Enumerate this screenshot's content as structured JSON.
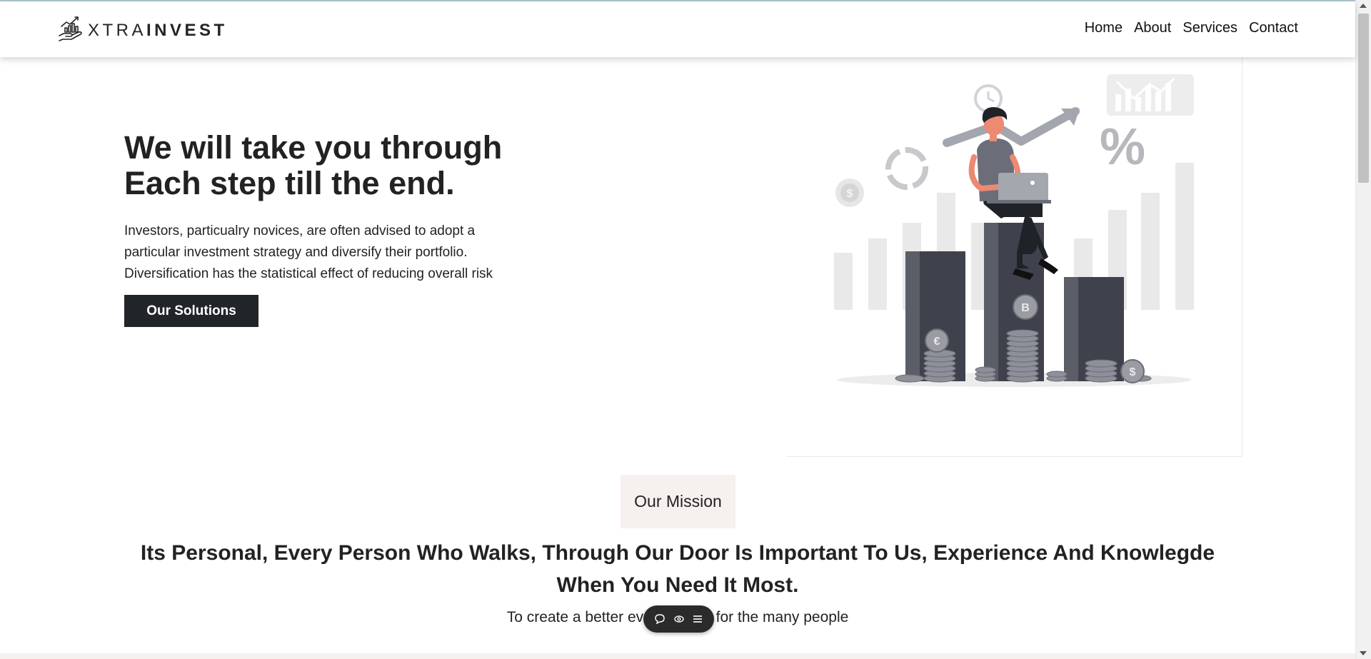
{
  "brand": {
    "name_light": "XTRA",
    "name_bold": "INVEST",
    "icon": "hand-chart-icon"
  },
  "nav": {
    "items": [
      {
        "label": "Home"
      },
      {
        "label": "About"
      },
      {
        "label": "Services"
      },
      {
        "label": "Contact"
      }
    ]
  },
  "hero": {
    "title_line1": "We will take you through",
    "title_line2": "Each step till the end.",
    "text_line1": "Investors, particualry novices, are often advised to adopt a",
    "text_line2": "particular investment strategy and diversify their portfolio.",
    "text_line3": "Diversification has the statistical effect of reducing overall risk",
    "button_label": "Our Solutions",
    "illustration": "investor-on-bar-chart-illustration"
  },
  "mission": {
    "badge": "Our Mission",
    "heading_line1": "Its Personal, Every Person Who Walks, Through Our Door Is Important To Us, Experience And Knowlegde",
    "heading_line2": "When You Need It Most.",
    "subtext": "To create a better everyday life for the many people"
  },
  "toolbar": {
    "icons": [
      "chat-icon",
      "eye-icon",
      "menu-icon"
    ]
  },
  "colors": {
    "dark": "#212529",
    "badge_bg": "#f6f1ee",
    "chart_dark": "#3f424c",
    "chart_light": "#e9e9ea",
    "accent": "#ec8a72"
  }
}
